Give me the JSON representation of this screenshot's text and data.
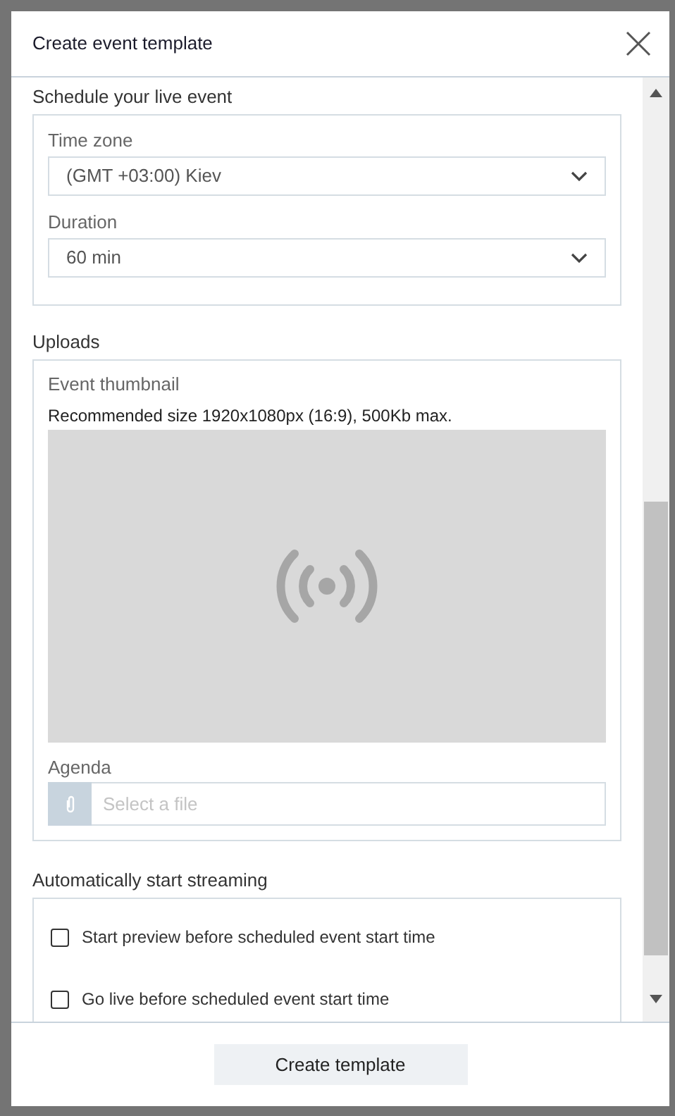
{
  "dialog": {
    "title": "Create event template"
  },
  "sections": [
    {
      "kind": "fields",
      "title": "Schedule your live event",
      "fields": [
        {
          "label": "Time zone",
          "value": "(GMT +03:00) Kiev"
        },
        {
          "label": "Duration",
          "value": "60 min"
        }
      ]
    },
    {
      "kind": "uploads",
      "title": "Uploads",
      "thumbnail_label": "Event thumbnail",
      "thumbnail_hint": "Recommended size 1920x1080px (16:9), 500Kb max.",
      "agenda_label": "Agenda",
      "agenda_placeholder": "Select a file"
    },
    {
      "kind": "checkboxes",
      "title": "Automatically start streaming",
      "options": [
        {
          "label": "Start preview before scheduled event start time",
          "checked": false
        },
        {
          "label": "Go live before scheduled event start time",
          "checked": false
        }
      ]
    }
  ],
  "footer": {
    "button": "Create template"
  }
}
